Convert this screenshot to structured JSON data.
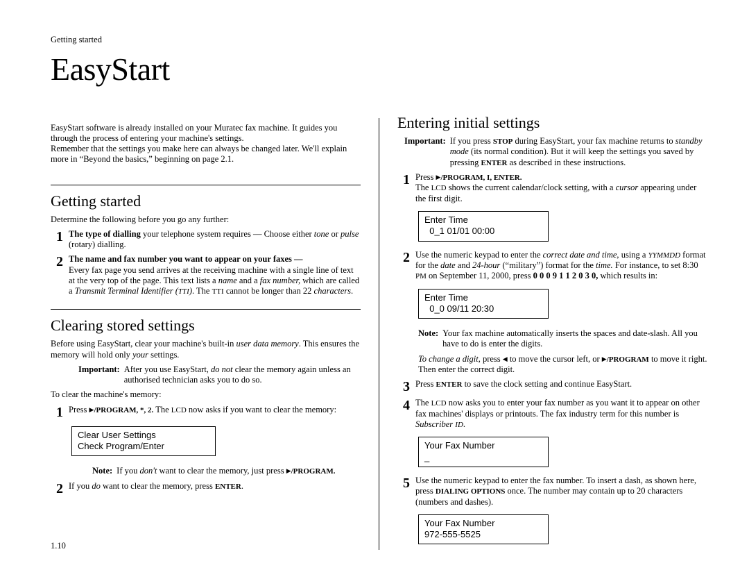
{
  "runningHead": "Getting started",
  "mainTitle": "EasyStart",
  "pageNumber": "1.10",
  "intro_a": "EasyStart software is already installed on your Muratec fax machine. It guides you through the process of entering your machine's settings.",
  "intro_b": "Remember that the settings you make here can always be changed later. We'll explain more in “Beyond the basics,” beginning on page 2.1.",
  "left": {
    "section1_title": "Getting started",
    "section1_lead": "Determine the following before you go any further:",
    "s1_item1_bold": "The type of dialling",
    "s1_item1_rest": " your telephone system requires — Choose either ",
    "s1_item1_tone": "tone",
    "s1_item1_or": " or ",
    "s1_item1_pulse": "pulse",
    "s1_item1_tail": " (rotary) dialling.",
    "s1_item2_bold": "The name and fax number you want to appear on your faxes —",
    "s1_item2_body": "Every fax page you send arrives at the receiving machine with a single line of text at the very top of the page. This text lists a ",
    "s1_item2_name": "name",
    "s1_item2_and": " and a ",
    "s1_item2_fax": "fax number,",
    "s1_item2_which": " which are called a ",
    "s1_item2_tti_i": "Transmit Terminal Identifier (",
    "s1_item2_tti_sc": "TTI",
    "s1_item2_tti_close": ")",
    "s1_item2_dot_the": ". The ",
    "s1_item2_tti2": "TTI",
    "s1_item2_tail": " cannot be longer than 22 ",
    "s1_item2_chars": "characters",
    "s1_item2_period": ".",
    "section2_title": "Clearing stored settings",
    "section2_lead_a": "Before using EasyStart, clear your machine's built-in ",
    "section2_lead_udm": "user data memory",
    "section2_lead_b": ". This ensures the memory will hold only ",
    "section2_lead_your": "your",
    "section2_lead_c": " settings.",
    "section2_imp_label": "Important:",
    "section2_imp_a": "After you use EasyStart, ",
    "section2_imp_donot": "do not",
    "section2_imp_b": " clear the memory again unless an authorised technician asks you to do so.",
    "section2_toclear": "To clear the machine's memory:",
    "s2_item1_a": "Press ",
    "s2_item1_keys": "/PROGRAM, *, 2.",
    "s2_item1_b": " The ",
    "s2_item1_lcd": "LCD",
    "s2_item1_c": " now asks if you want to clear the memory:",
    "s2_lcd1": "Clear User Settings\nCheck Program/Enter",
    "s2_note_label": "Note:",
    "s2_note_a": "If you ",
    "s2_note_dont": "don't",
    "s2_note_b": " want to clear the memory, just press ",
    "s2_note_keys": "/PROGRAM.",
    "s2_item2_a": "If you ",
    "s2_item2_do": "do",
    "s2_item2_b": " want to clear the memory, press ",
    "s2_item2_enter": "ENTER",
    "s2_item2_c": "."
  },
  "right": {
    "section_title": "Entering initial settings",
    "imp_label": "Important:",
    "imp_a": "If you press ",
    "imp_stop": "STOP",
    "imp_b": " during EasyStart, your fax machine returns to ",
    "imp_standby": "standby mode",
    "imp_c": " (its normal condition). But it will keep the settings you saved by pressing ",
    "imp_enter": "ENTER",
    "imp_d": " as described in these instructions.",
    "r1_a": "Press ",
    "r1_keys": "/PROGRAM, I, ENTER.",
    "r1_b": "The ",
    "r1_lcd": "LCD",
    "r1_c": " shows the current calendar/clock setting, with a ",
    "r1_cursor": "cursor",
    "r1_d": " appearing under the first digit.",
    "r1_lcdbox": "Enter Time\n  0_1 01/01 00:00",
    "r2_a": "Use the numeric keypad to enter the ",
    "r2_cdt": "correct date and time,",
    "r2_b": " using a ",
    "r2_yy": "YYMMDD",
    "r2_c": " format for the ",
    "r2_date": "date",
    "r2_d": " and ",
    "r2_24": "24-hour",
    "r2_e": " (“military”) format for the ",
    "r2_time": "time.",
    "r2_f": " For instance, to set 8:30 ",
    "r2_pm": "PM",
    "r2_g": " on September 11, 2000, press ",
    "r2_digits": "0 0 0 9 1 1 2 0 3 0,",
    "r2_h": " which results in:",
    "r2_lcdbox": "Enter Time\n  0_0 09/11 20:30",
    "r2_note_label": "Note:",
    "r2_note_a": "Your fax machine automatically inserts the spaces and date-slash. All you have to do is enter the digits.",
    "r2_change_a": "To change a digit,",
    "r2_change_b": " press ",
    "r2_change_c": " to move the cursor left, or ",
    "r2_change_keys": "/PROGRAM",
    "r2_change_d": " to move it right. Then enter the correct digit.",
    "r3_a": "Press ",
    "r3_enter": "ENTER",
    "r3_b": " to save the clock setting and continue EasyStart.",
    "r4_a": "The ",
    "r4_lcd": "LCD",
    "r4_b": " now asks you to enter your fax number as you want it to appear on other fax machines' displays or printouts. The fax industry term for this number is ",
    "r4_sid": "Subscriber ",
    "r4_id": "ID",
    "r4_c": ".",
    "r4_lcdbox": "Your Fax Number\n_",
    "r5_a": "Use the numeric keypad to enter the fax number. To insert a dash, as shown here, press ",
    "r5_dial": "DIALING OPTIONS",
    "r5_b": " once. The number may contain up to 20 characters (numbers and dashes).",
    "r5_lcdbox": "Your Fax Number\n972-555-5525"
  }
}
